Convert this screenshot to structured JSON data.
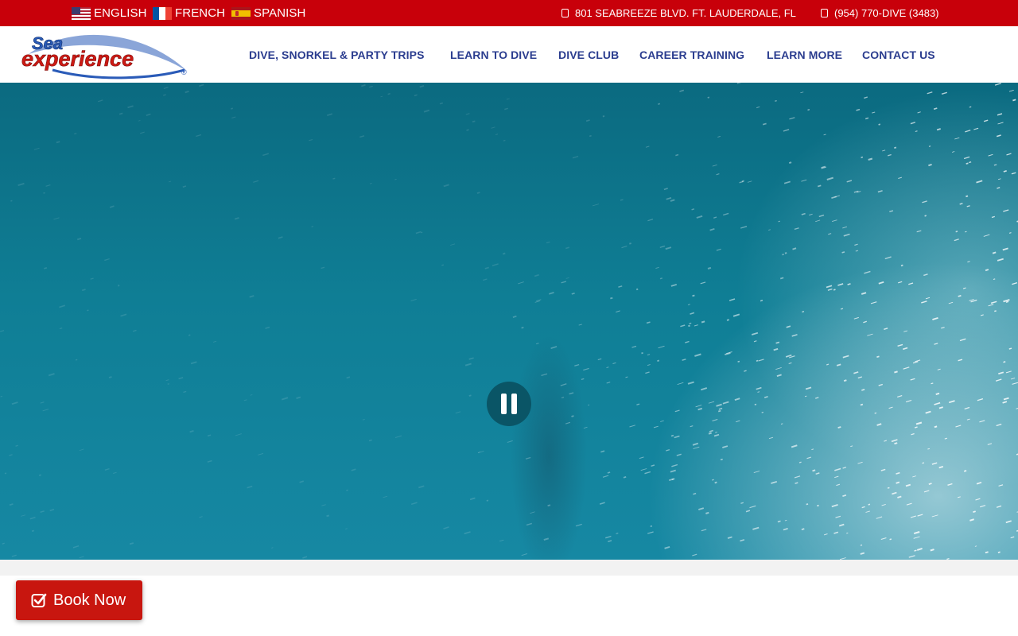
{
  "languages": [
    {
      "label": "ENGLISH",
      "flag": "us-flag-icon"
    },
    {
      "label": "FRENCH",
      "flag": "fr-flag-icon"
    },
    {
      "label": "SPANISH",
      "flag": "es-flag-icon"
    }
  ],
  "contact": {
    "address": "801 SEABREEZE BLVD. FT. LAUDERDALE, FL",
    "phone": "(954) 770-DIVE (3483)"
  },
  "logo": {
    "line1": "Sea",
    "line2": "experience",
    "mark": "®"
  },
  "nav": [
    {
      "label": "DIVE, SNORKEL & PARTY TRIPS"
    },
    {
      "label": "LEARN TO DIVE"
    },
    {
      "label": "DIVE CLUB"
    },
    {
      "label": "CAREER TRAINING"
    },
    {
      "label": "LEARN MORE"
    },
    {
      "label": "CONTACT US"
    }
  ],
  "hero": {
    "control": "pause-icon"
  },
  "cta": {
    "label": "Book Now",
    "icon": "check-square-icon"
  },
  "colors": {
    "topbar": "#c8000a",
    "nav_text": "#2b3d8f",
    "cta": "#c8160f",
    "water": "#0f7e95"
  }
}
